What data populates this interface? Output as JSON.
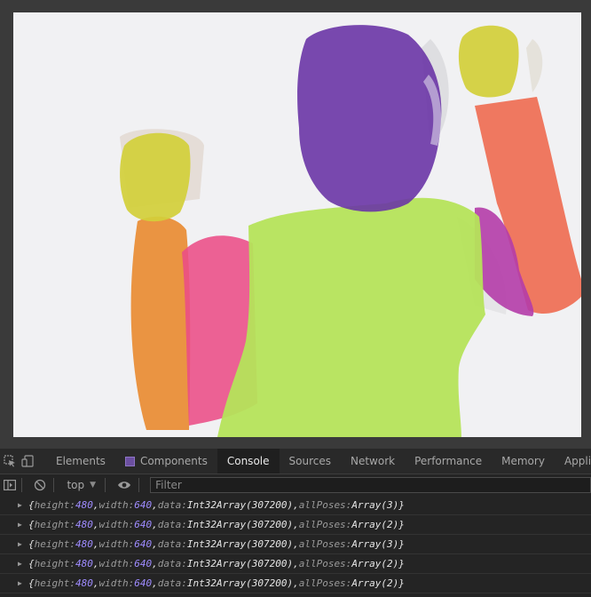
{
  "devtools": {
    "tabs": [
      {
        "label": "Elements",
        "active": false
      },
      {
        "label": "Components",
        "active": false,
        "icon": "react-components-icon"
      },
      {
        "label": "Console",
        "active": true
      },
      {
        "label": "Sources",
        "active": false
      },
      {
        "label": "Network",
        "active": false
      },
      {
        "label": "Performance",
        "active": false
      },
      {
        "label": "Memory",
        "active": false
      },
      {
        "label": "Applicatio",
        "active": false
      }
    ],
    "toolbar_icons": [
      "inspect-element-icon",
      "device-toolbar-icon"
    ]
  },
  "console": {
    "context": "top",
    "filter_placeholder": "Filter",
    "entries": [
      {
        "open": "{",
        "height_key": "height:",
        "height": "480",
        "width_key": "width:",
        "width": "640",
        "data_key": "data:",
        "data": "Int32Array(307200)",
        "poses_key": "allPoses:",
        "poses": "Array(3)",
        "close": "}"
      },
      {
        "open": "{",
        "height_key": "height:",
        "height": "480",
        "width_key": "width:",
        "width": "640",
        "data_key": "data:",
        "data": "Int32Array(307200)",
        "poses_key": "allPoses:",
        "poses": "Array(2)",
        "close": "}"
      },
      {
        "open": "{",
        "height_key": "height:",
        "height": "480",
        "width_key": "width:",
        "width": "640",
        "data_key": "data:",
        "data": "Int32Array(307200)",
        "poses_key": "allPoses:",
        "poses": "Array(3)",
        "close": "}"
      },
      {
        "open": "{",
        "height_key": "height:",
        "height": "480",
        "width_key": "width:",
        "width": "640",
        "data_key": "data:",
        "data": "Int32Array(307200)",
        "poses_key": "allPoses:",
        "poses": "Array(2)",
        "close": "}"
      },
      {
        "open": "{",
        "height_key": "height:",
        "height": "480",
        "width_key": "width:",
        "width": "640",
        "data_key": "data:",
        "data": "Int32Array(307200)",
        "poses_key": "allPoses:",
        "poses": "Array(2)",
        "close": "}"
      }
    ]
  },
  "colors": {
    "torso": "#b5e35a",
    "head": "#6a35a6",
    "hands": "#d2cf3a",
    "left_upper_arm": "#ea4c86",
    "left_forearm": "#e9892f",
    "right_forearm": "#ee6a50",
    "right_upper_arm": "#b43ca8"
  }
}
